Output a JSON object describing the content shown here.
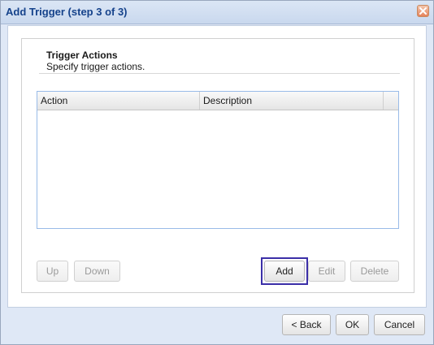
{
  "dialog": {
    "title": "Add Trigger (step 3 of 3)"
  },
  "section": {
    "title": "Trigger Actions",
    "description": "Specify trigger actions."
  },
  "grid": {
    "columns": [
      "Action",
      "Description"
    ],
    "rows": []
  },
  "list_buttons": {
    "up": "Up",
    "down": "Down",
    "add": "Add",
    "edit": "Edit",
    "delete": "Delete"
  },
  "footer_buttons": {
    "back": "< Back",
    "ok": "OK",
    "cancel": "Cancel"
  },
  "icons": {
    "close": "close-icon"
  },
  "colors": {
    "title_text": "#15428b",
    "focus_ring": "#3b2fa8",
    "close_button": "#e5825a"
  }
}
